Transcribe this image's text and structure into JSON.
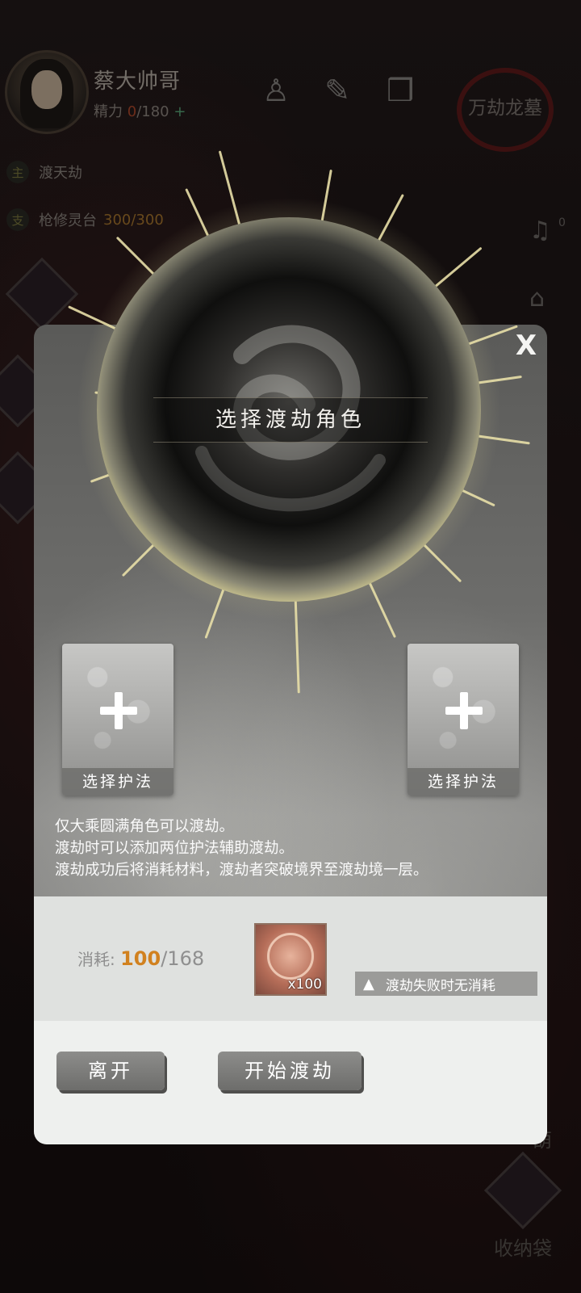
{
  "player": {
    "name": "蔡大帅哥",
    "stamina_label": "精力",
    "stamina_current": "0",
    "stamina_max": "/180",
    "stamina_plus": "+"
  },
  "location": {
    "label": "万劫龙墓"
  },
  "quests": [
    {
      "tag": "主",
      "title": "渡天劫",
      "progress": ""
    },
    {
      "tag": "支",
      "title": "枪修灵台",
      "progress": "300/300"
    }
  ],
  "side": {
    "music_count": "0",
    "gourd_label": "葫",
    "bag_label": "收纳袋"
  },
  "dialog": {
    "title": "选择渡劫角色",
    "close": "X",
    "slots": [
      {
        "label": "选择护法"
      },
      {
        "label": "选择护法"
      }
    ],
    "rules": [
      "仅大乘圆满角色可以渡劫。",
      "渡劫时可以添加两位护法辅助渡劫。",
      "渡劫成功后将消耗材料，渡劫者突破境界至渡劫境一层。"
    ],
    "cost": {
      "label": "消耗:",
      "have": "100",
      "need": "/168",
      "item_qty": "x100"
    },
    "warning": "渡劫失败时无消耗",
    "buttons": {
      "leave": "离开",
      "start": "开始渡劫"
    }
  },
  "colors": {
    "accent_orange": "#d1811f",
    "stamina_red": "#b04a2c",
    "stamina_green": "#5aa87a",
    "panel_light": "#dfe1df"
  },
  "icons": [
    "person-icon",
    "scroll-icon",
    "book-icon",
    "music-icon",
    "pagoda-icon",
    "warning-icon",
    "plus-icon",
    "close-icon"
  ]
}
